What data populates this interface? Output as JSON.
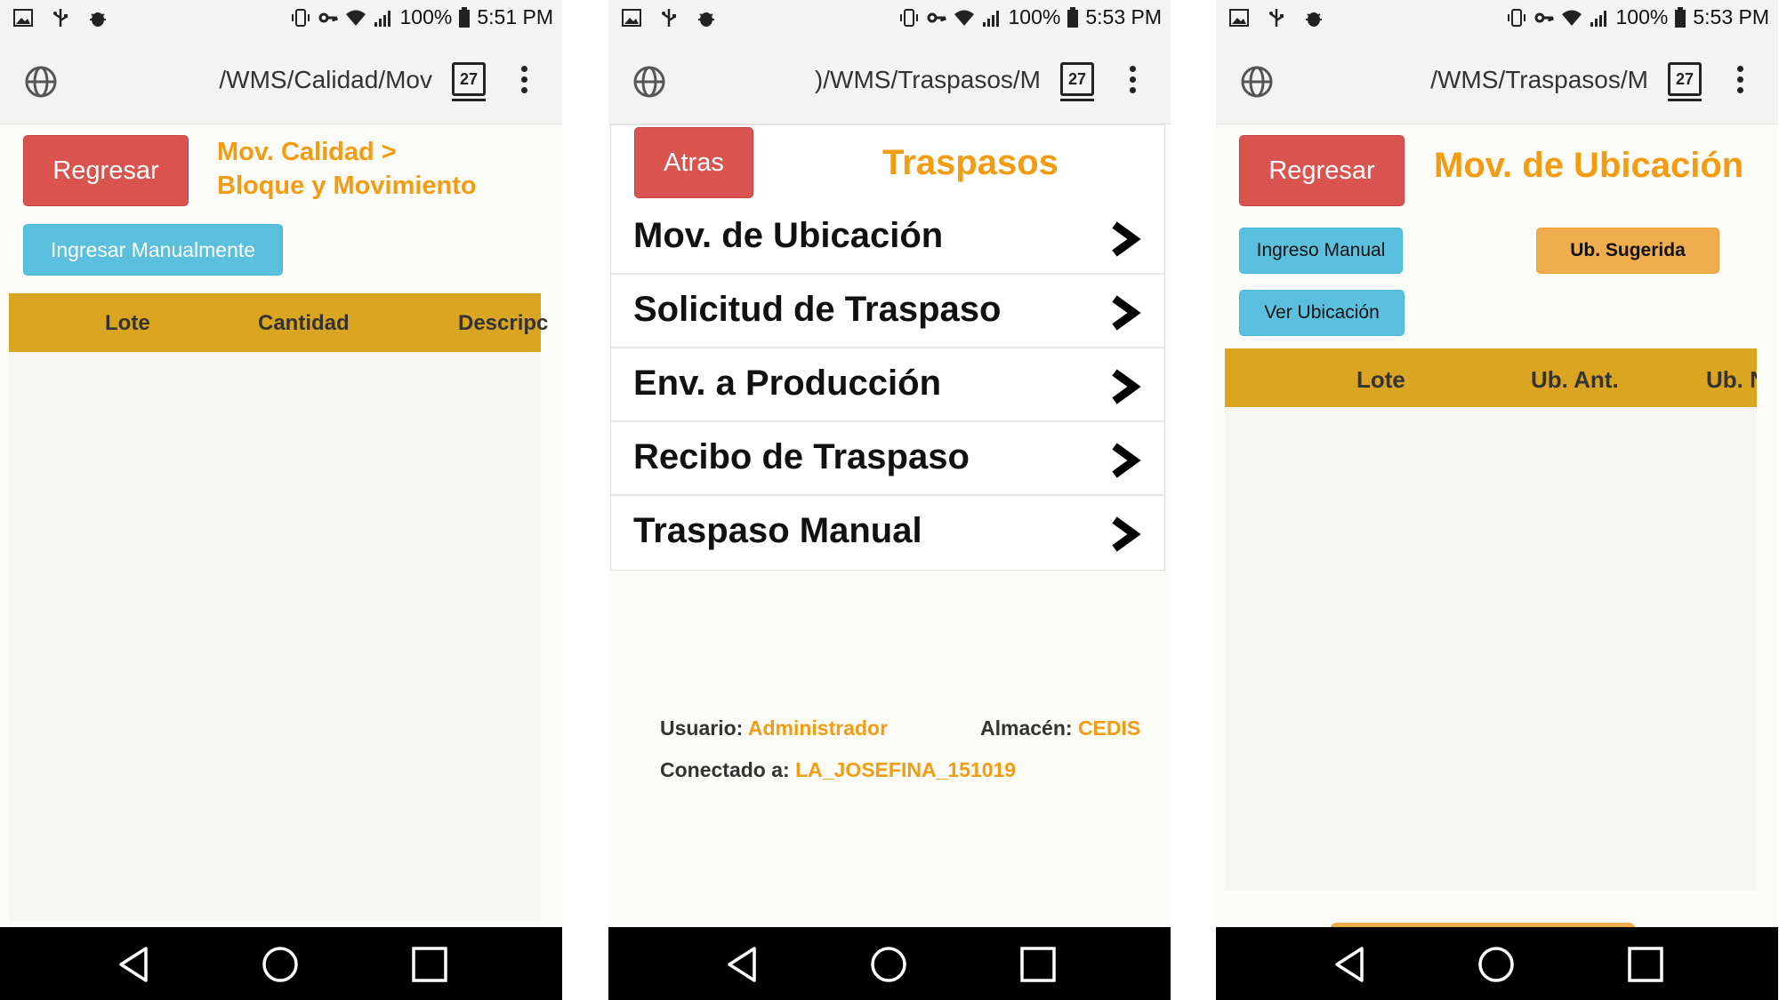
{
  "phones": [
    {
      "status": {
        "battery": "100%",
        "time": "5:51 PM"
      },
      "url": "/WMS/Calidad/Mov",
      "tab_count": "27",
      "back_label": "Regresar",
      "title_line1": "Mov. Calidad >",
      "title_line2": "Bloque y Movimiento",
      "manual_label": "Ingresar Manualmente",
      "table_headers": [
        "Lote",
        "Cantidad",
        "Descripc"
      ]
    },
    {
      "status": {
        "battery": "100%",
        "time": "5:53 PM"
      },
      "url": ")/WMS/Traspasos/M",
      "tab_count": "27",
      "back_label": "Atras",
      "title": "Traspasos",
      "menu": [
        "Mov. de Ubicación",
        "Solicitud de Traspaso",
        "Env. a Producción",
        "Recibo de Traspaso",
        "Traspaso Manual"
      ],
      "user_label": "Usuario:",
      "user_value": "Administrador",
      "warehouse_label": "Almacén:",
      "warehouse_value": "CEDIS",
      "connected_label": "Conectado a:",
      "connected_value": "LA_JOSEFINA_151019"
    },
    {
      "status": {
        "battery": "100%",
        "time": "5:53 PM"
      },
      "url": "/WMS/Traspasos/M",
      "tab_count": "27",
      "back_label": "Regresar",
      "title": "Mov. de Ubicación",
      "manual_label": "Ingreso Manual",
      "suggested_label": "Ub. Sugerida",
      "view_label": "Ver Ubicación",
      "table_headers": [
        "Lote",
        "Ub. Ant.",
        "Ub. N"
      ]
    }
  ],
  "colors": {
    "danger": "#d9534f",
    "info": "#5bc0de",
    "warning": "#f0ad4e",
    "title": "#f39c12",
    "table_header": "#daa520"
  }
}
